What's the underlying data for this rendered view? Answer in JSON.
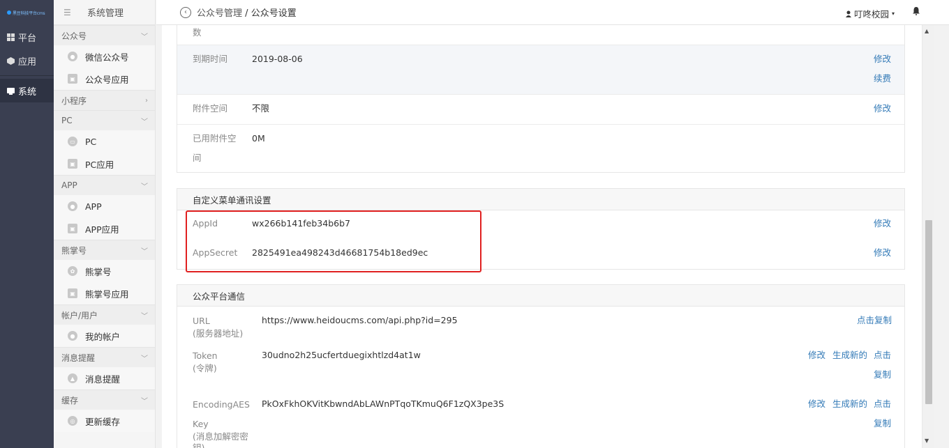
{
  "rail": {
    "logo_text": "黑豆科技平台cms",
    "items": [
      {
        "label": "平台"
      },
      {
        "label": "应用"
      },
      {
        "label": "系统"
      }
    ]
  },
  "menu": {
    "header": "系统管理",
    "groups": [
      {
        "title": "公众号",
        "items": [
          "微信公众号",
          "公众号应用"
        ]
      },
      {
        "title": "小程序",
        "items": []
      },
      {
        "title": "PC",
        "items": [
          "PC",
          "PC应用"
        ]
      },
      {
        "title": "APP",
        "items": [
          "APP",
          "APP应用"
        ]
      },
      {
        "title": "熊掌号",
        "items": [
          "熊掌号",
          "熊掌号应用"
        ]
      },
      {
        "title": "帐户/用户",
        "items": [
          "我的帐户"
        ]
      },
      {
        "title": "消息提醒",
        "items": [
          "消息提醒"
        ]
      },
      {
        "title": "缓存",
        "items": [
          "更新缓存"
        ]
      }
    ]
  },
  "topbar": {
    "crumb_parent": "公众号管理",
    "crumb_sep": "/",
    "crumb_current": "公众号设置",
    "user_name": "叮咚校园"
  },
  "basic": {
    "cut_label": "数",
    "expire_label": "到期时间",
    "expire_value": "2019-08-06",
    "expire_edit": "修改",
    "expire_renew": "续费",
    "attach_label": "附件空间",
    "attach_value": "不限",
    "attach_edit": "修改",
    "used_label_1": "已用附件空",
    "used_label_2": "间",
    "used_value": "0M"
  },
  "menu_comm": {
    "title": "自定义菜单通讯设置",
    "appid_label": "AppId",
    "appid_value": "wx266b141feb34b6b7",
    "appid_edit": "修改",
    "secret_label": "AppSecret",
    "secret_value": "2825491ea498243d46681754b18ed9ec",
    "secret_edit": "修改"
  },
  "platform": {
    "title": "公众平台通信",
    "url_label": "URL",
    "url_sub": "(服务器地址)",
    "url_value": "https://www.heidoucms.com/api.php?id=295",
    "url_copy": "点击复制",
    "token_label": "Token",
    "token_sub": "(令牌)",
    "token_value": "30udno2h25ucfertduegixhtlzd4at1w",
    "token_edit": "修改",
    "token_gen": "生成新的",
    "token_copy_1": "点击",
    "token_copy_2": "复制",
    "aes_label_1": "EncodingAES",
    "aes_label_2": "Key",
    "aes_label_3": "(消息加解密密",
    "aes_label_4": "钥)",
    "aes_value": "PkOxFkhOKVitKbwndAbLAWnPTqoTKmuQ6F1zQX3pe3S",
    "aes_edit": "修改",
    "aes_gen": "生成新的",
    "aes_copy_1": "点击",
    "aes_copy_2": "复制"
  }
}
